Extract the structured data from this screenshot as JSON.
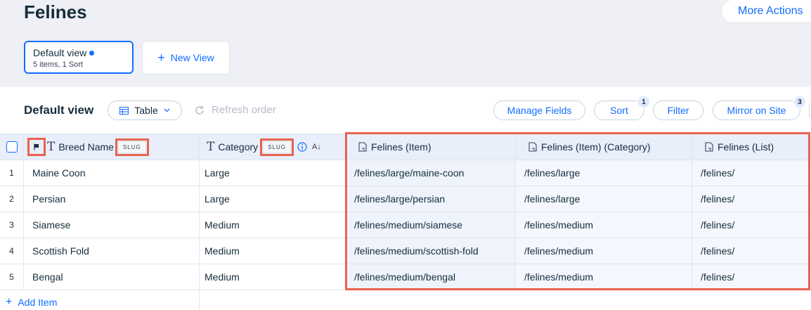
{
  "page": {
    "title": "Felines",
    "more_actions": "More Actions"
  },
  "views": {
    "active": {
      "name": "Default view",
      "summary": "5 items, 1 Sort"
    },
    "new_view_label": "New View"
  },
  "toolbar": {
    "title": "Default view",
    "layout_label": "Table",
    "refresh_label": "Refresh order",
    "manage_fields": "Manage Fields",
    "sort": "Sort",
    "sort_count": "1",
    "filter": "Filter",
    "mirror": "Mirror on Site",
    "mirror_count": "3"
  },
  "table": {
    "columns": {
      "breed": "Breed Name",
      "category": "Category",
      "slug_tag": "SLUG",
      "item": "Felines (Item)",
      "item_category": "Felines (Item) (Category)",
      "list": "Felines (List)"
    },
    "rows": [
      {
        "n": "1",
        "breed": "Maine Coon",
        "category": "Large",
        "item": "/felines/large/maine-coon",
        "item_category": "/felines/large",
        "list": "/felines/"
      },
      {
        "n": "2",
        "breed": "Persian",
        "category": "Large",
        "item": "/felines/large/persian",
        "item_category": "/felines/large",
        "list": "/felines/"
      },
      {
        "n": "3",
        "breed": "Siamese",
        "category": "Medium",
        "item": "/felines/medium/siamese",
        "item_category": "/felines/medium",
        "list": "/felines/"
      },
      {
        "n": "4",
        "breed": "Scottish Fold",
        "category": "Medium",
        "item": "/felines/medium/scottish-fold",
        "item_category": "/felines/medium",
        "list": "/felines/"
      },
      {
        "n": "5",
        "breed": "Bengal",
        "category": "Medium",
        "item": "/felines/medium/bengal",
        "item_category": "/felines/medium",
        "list": "/felines/"
      }
    ],
    "add_item": "Add Item"
  },
  "colors": {
    "accent": "#116dff",
    "highlight": "#e8634e",
    "header_bg": "#e8eefa"
  }
}
